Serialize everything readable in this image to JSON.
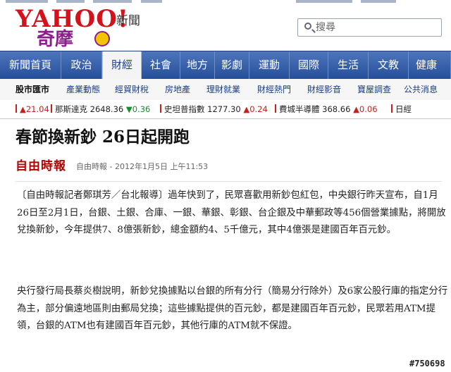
{
  "header": {
    "logo_text": "YAHOO!",
    "logo_sub": "奇摩",
    "section_title": "新聞",
    "search_placeholder": "搜尋"
  },
  "nav": {
    "items": [
      "新聞首頁",
      "政治",
      "財經",
      "社會",
      "地方",
      "影劇",
      "運動",
      "國際",
      "生活",
      "文教",
      "健康"
    ],
    "active": "財經"
  },
  "subnav": {
    "items": [
      "股市匯市",
      "產業動態",
      "經貿財稅",
      "房地產",
      "理財就業",
      "財經熱門",
      "財經影音",
      "寶屋調查",
      "公共消息"
    ],
    "active": "股市匯市"
  },
  "ticker": [
    {
      "change": "▲21.04",
      "direction": "up"
    },
    {
      "name": "那斯達克",
      "value": "2648.36",
      "change": "▼0.36",
      "direction": "down"
    },
    {
      "name": "史坦普指數",
      "value": "1277.30",
      "change": "▲0.24",
      "direction": "up"
    },
    {
      "name": "費城半導體",
      "value": "368.66",
      "change": "▲0.06",
      "direction": "up"
    },
    {
      "name": "日經"
    }
  ],
  "article": {
    "title": "春節換新鈔 26日起開跑",
    "source_logo": "自由時報",
    "byline": "自由時報 - 2012年1月5日 上午11:53",
    "paragraphs": [
      "〔自由時報記者鄭琪芳／台北報導〕過年快到了，民眾喜歡用新鈔包紅包，中央銀行昨天宣布，自1月26日至2月1日，台銀、土銀、合庫、一銀、華銀、彰銀、台企銀及中華郵政等456個營業據點，將開放兌換新鈔，今年提供7、8億張新鈔，總金額約4、5千億元，其中4億張是建國百年百元鈔。",
      "央行發行局長蔡炎樹說明，新鈔兌換據點以台銀的所有分行（簡易分行除外）及6家公股行庫的指定分行為主，部分偏遠地區則由郵局兌換；這些據點提供的百元鈔，都是建國百年百元鈔，民眾若用ATM提領，台銀的ATM也有建國百年百元鈔，其他行庫的ATM就不保證。"
    ]
  },
  "watermark": "#750698",
  "colors": {
    "nav_top": "#4d76bc",
    "nav_bottom": "#254e98",
    "up": "#c8201a",
    "down": "#1b8a2b",
    "logo_red": "#d3121b",
    "logo_purple": "#8c1e8c"
  }
}
